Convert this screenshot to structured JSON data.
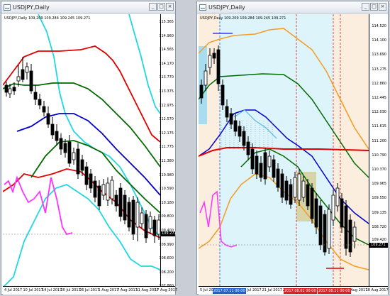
{
  "left_window": {
    "title": "USDJPY,Daily",
    "info": "USDJPY,Daily 109.209 109.284 109.245 109.271",
    "y_labels": [
      "115.365",
      "114.960",
      "114.565",
      "114.170",
      "113.770",
      "113.375",
      "112.975",
      "112.570",
      "112.175",
      "111.775",
      "111.380",
      "110.980",
      "110.590",
      "110.180",
      "109.800",
      "109.400",
      "108.990",
      "108.600",
      "108.200",
      "107.860"
    ],
    "current_price": "109.271",
    "x_labels": [
      "4 Jul 2017",
      "10 Jul 2017",
      "14 Jul 2017",
      "20 Jul 2017",
      "26 Jul 2017",
      "1 Aug 2017",
      "7 Aug 2017",
      "11 Aug 2017",
      "17 Aug 2017"
    ]
  },
  "right_window": {
    "title": "USDJPY,Daily",
    "info": "USDJPY,Daily 109.209 109.284 109.245 109.271",
    "y_labels": [
      "114.520",
      "114.100",
      "113.690",
      "113.275",
      "112.860",
      "112.445",
      "112.030",
      "111.615",
      "111.200",
      "110.790",
      "110.370",
      "109.965",
      "109.550",
      "109.135",
      "108.720"
    ],
    "y_labels_lower": [
      "109.420"
    ],
    "current_price": "109.271",
    "x_labels": [
      "5 Jul 2017",
      "11 Jul 2017",
      "17 Jul 2017",
      "21 Jul 2017",
      "27 Jul 2017",
      "2 Aug 2017",
      "8 Aug 2017",
      "14 Aug 2017",
      "18 Aug 2017"
    ],
    "time_tags": [
      "2017.07.11 00:00",
      "2017.08.02 00:00",
      "2017.08.11 00:00"
    ]
  },
  "colors": {
    "bb_outer_left": "#1fd8e0",
    "bb_red": "#e00000",
    "bb_green": "#006a00",
    "bb_blue": "#0000d0",
    "magenta": "#ff33ff",
    "orange": "#f59b20",
    "right_bg_cyan": "#ddf4fb",
    "right_bg_tan": "#fbeede",
    "khaki_box": "#d6cf99",
    "tag_red": "#e02020",
    "tag_blue": "#2060d0"
  },
  "window_controls": {
    "minimize": "_",
    "maximize": "□",
    "close": "×"
  },
  "icons": [
    "chart-window-icon",
    "minimize-icon",
    "maximize-icon",
    "close-icon"
  ]
}
